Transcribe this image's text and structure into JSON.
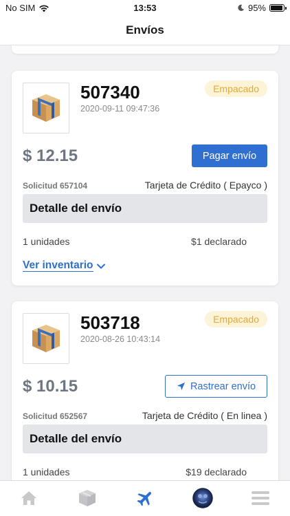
{
  "status_bar": {
    "carrier": "No SIM",
    "time": "13:53",
    "battery": "95%",
    "battery_level": 0.95
  },
  "header": {
    "title": "Envíos"
  },
  "shipments": [
    {
      "id": "507340",
      "date": "2020-09-11 09:47:36",
      "status": "Empacado",
      "price": "$ 12.15",
      "action_label": "Pagar envío",
      "request": "Solicitud 657104",
      "payment_method": "Tarjeta de Crédito ( Epayco )",
      "detail_title": "Detalle del envío",
      "units": "1 unidades",
      "declared": "$1 declarado",
      "inventory_link": "Ver inventario"
    },
    {
      "id": "503718",
      "date": "2020-08-26 10:43:14",
      "status": "Empacado",
      "price": "$ 10.15",
      "action_label": "Rastrear envío",
      "request": "Solicitud 652567",
      "payment_method": "Tarjeta de Crédito ( En linea )",
      "detail_title": "Detalle del envío",
      "units": "1 unidades",
      "declared": "$19 declarado"
    }
  ],
  "tabbar": {
    "items": [
      "home-icon",
      "box-icon",
      "airplane-icon",
      "avatar",
      "menu-icon"
    ],
    "active": "airplane-icon"
  },
  "colors": {
    "primary": "#2f6fd1",
    "badge_bg": "#fdf3d6",
    "badge_text": "#e2a93a",
    "price": "#6e7681"
  }
}
